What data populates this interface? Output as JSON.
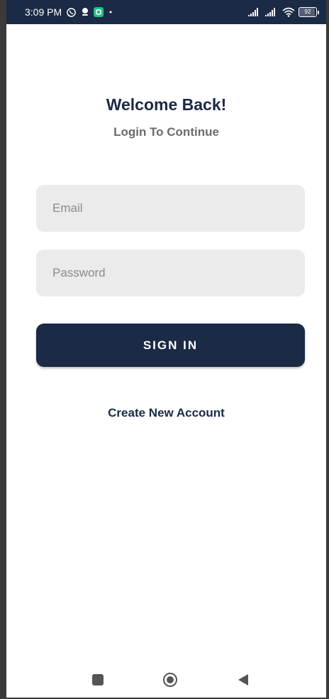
{
  "status_bar": {
    "time": "3:09 PM",
    "battery_text": "92",
    "battery_level": 0.92,
    "icons": [
      "whatsapp-icon",
      "notification-icon",
      "app-icon",
      "dot-icon",
      "signal-icon",
      "signal-icon-2",
      "wifi-icon",
      "battery-icon"
    ]
  },
  "login": {
    "title": "Welcome Back!",
    "subtitle": "Login To Continue",
    "email_placeholder": "Email",
    "email_value": "",
    "password_placeholder": "Password",
    "password_value": "",
    "signin_label": "SIGN IN",
    "create_account_label": "Create New Account"
  },
  "nav_bar": {
    "icons": [
      "recents-icon",
      "home-icon",
      "back-icon"
    ]
  },
  "colors": {
    "primary": "#1b2a45",
    "field_bg": "#ebebeb",
    "subtitle": "#6b6b6b",
    "accent_green": "#23c08a"
  }
}
